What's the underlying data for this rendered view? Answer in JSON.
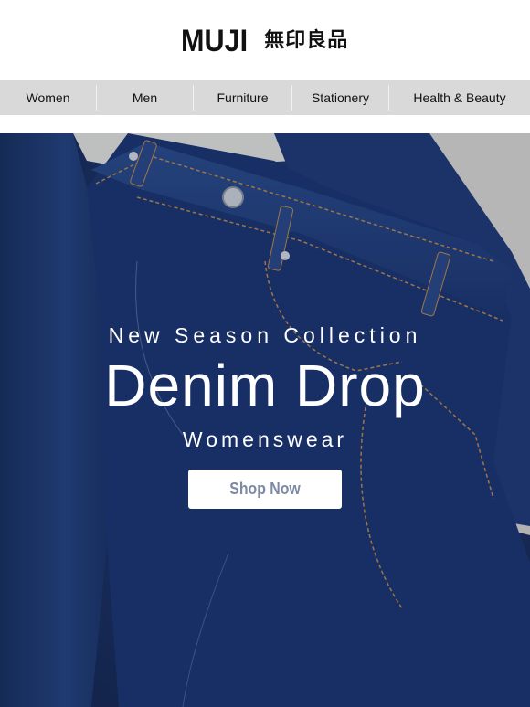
{
  "brand": {
    "name_latin": "MUJI",
    "name_japanese": "無印良品"
  },
  "nav": {
    "items": [
      {
        "label": "Women"
      },
      {
        "label": "Men"
      },
      {
        "label": "Furniture"
      },
      {
        "label": "Stationery"
      },
      {
        "label": "Health & Beauty"
      }
    ]
  },
  "hero": {
    "eyebrow": "New Season Collection",
    "headline": "Denim Drop",
    "subhead": "Womenswear",
    "cta_label": "Shop Now",
    "image": "folded-denim-jeans-photo"
  },
  "colors": {
    "nav_background": "#d9d9d9",
    "denim_dark": "#132349",
    "denim_mid": "#1d3468",
    "cta_text": "#7d8aa3",
    "stitching": "#c08a4a"
  }
}
